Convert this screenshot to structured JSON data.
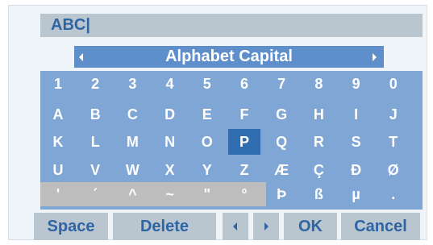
{
  "input": {
    "value": "ABC|"
  },
  "mode": {
    "label": "Alphabet Capital",
    "prev_icon": "left-arrow-icon",
    "next_icon": "right-arrow-icon"
  },
  "keys": {
    "row1": [
      "1",
      "2",
      "3",
      "4",
      "5",
      "6",
      "7",
      "8",
      "9",
      "0"
    ],
    "row2": [
      "A",
      "B",
      "C",
      "D",
      "E",
      "F",
      "G",
      "H",
      "I",
      "J"
    ],
    "row3": [
      "K",
      "L",
      "M",
      "N",
      "O",
      "P",
      "Q",
      "R",
      "S",
      "T"
    ],
    "row4": [
      "U",
      "V",
      "W",
      "X",
      "Y",
      "Z",
      "Æ",
      "Ç",
      "Đ",
      "Ø"
    ],
    "row5": [
      "'",
      "´",
      "^",
      "~",
      "\"",
      "°",
      "Þ",
      "ß",
      "µ",
      "."
    ],
    "selected": "P"
  },
  "buttons": {
    "space": "Space",
    "delete": "Delete",
    "cursor_left_icon": "left-arrow-icon",
    "cursor_right_icon": "right-arrow-icon",
    "ok": "OK",
    "cancel": "Cancel"
  },
  "colors": {
    "panel": "#eef4f8",
    "key_area": "#7fa6d5",
    "mode_bar": "#5f8fcb",
    "selected_key": "#2f6db0",
    "button_bg": "#b9c6cf",
    "button_text": "#2f64a3"
  }
}
